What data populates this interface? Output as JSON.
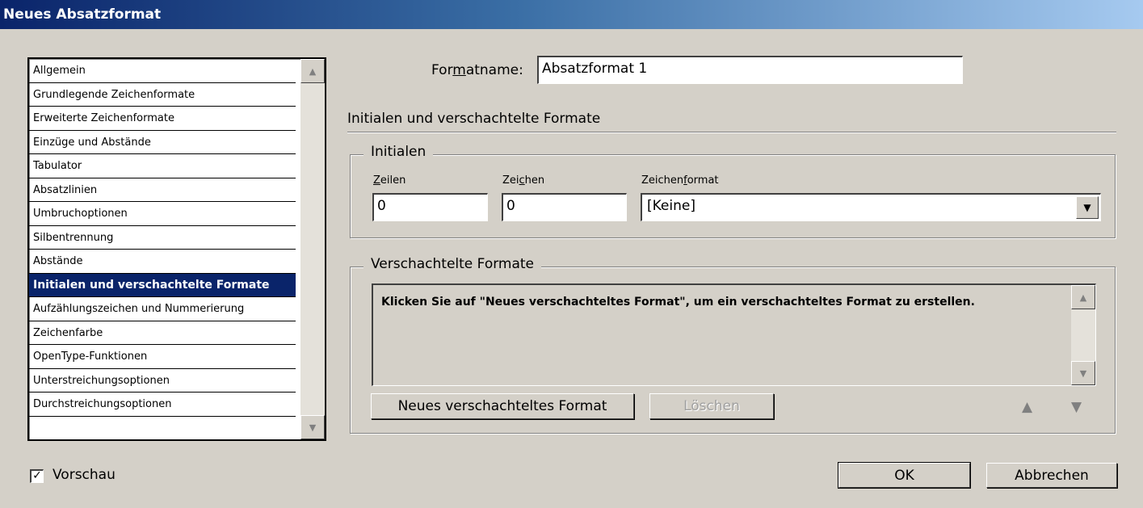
{
  "window": {
    "title": "Neues Absatzformat"
  },
  "sidebar": {
    "items": [
      {
        "label": "Allgemein"
      },
      {
        "label": "Grundlegende Zeichenformate"
      },
      {
        "label": "Erweiterte Zeichenformate"
      },
      {
        "label": "Einzüge und Abstände"
      },
      {
        "label": "Tabulator"
      },
      {
        "label": "Absatzlinien"
      },
      {
        "label": "Umbruchoptionen"
      },
      {
        "label": "Silbentrennung"
      },
      {
        "label": "Abstände"
      },
      {
        "label": "Initialen und verschachtelte Formate",
        "selected": true
      },
      {
        "label": "Aufzählungszeichen und Nummerierung"
      },
      {
        "label": "Zeichenfarbe"
      },
      {
        "label": "OpenType-Funktionen"
      },
      {
        "label": "Unterstreichungsoptionen"
      },
      {
        "label": "Durchstreichungsoptionen"
      }
    ]
  },
  "formatname": {
    "label_pre": "For",
    "label_accel": "m",
    "label_post": "atname:",
    "value": "Absatzformat 1"
  },
  "section": {
    "title": "Initialen und verschachtelte Formate"
  },
  "initials": {
    "legend": "Initialen",
    "lines_accel": "Z",
    "lines_rest": "eilen",
    "lines_value": "0",
    "chars_pre": "Zei",
    "chars_accel": "c",
    "chars_post": "hen",
    "chars_value": "0",
    "charformat_pre": "Zeichen",
    "charformat_accel": "f",
    "charformat_post": "ormat",
    "charformat_value": "[Keine]"
  },
  "nested": {
    "legend": "Verschachtelte Formate",
    "hint": "Klicken Sie auf \"Neues verschachteltes Format\", um ein verschachteltes Format zu erstellen.",
    "new_button": "Neues verschachteltes Format",
    "delete_button": "Löschen"
  },
  "footer": {
    "preview_label": "Vorschau",
    "preview_checked": true,
    "ok_button": "OK",
    "cancel_button": "Abbrechen"
  },
  "icons": {
    "scroll_up": "scroll-up-arrow-icon",
    "scroll_down": "scroll-down-arrow-icon",
    "dropdown": "dropdown-arrow-icon",
    "move_up": "move-up-triangle-icon",
    "move_down": "move-down-triangle-icon",
    "check": "checkmark-icon"
  },
  "colors": {
    "dialog_bg": "#d4d0c8",
    "title_gradient_start": "#0a246a",
    "title_gradient_end": "#a6caf0",
    "selection": "#0a246a"
  }
}
